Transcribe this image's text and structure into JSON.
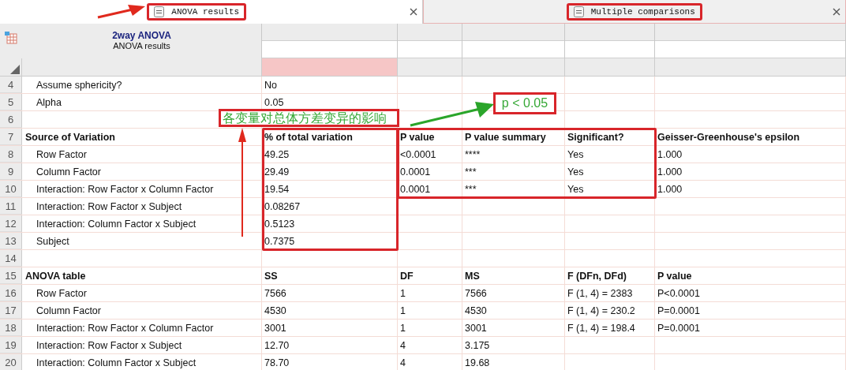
{
  "tabs": [
    {
      "label": "ANOVA results",
      "selected": true
    },
    {
      "label": "Multiple comparisons",
      "selected": false
    }
  ],
  "sheet": {
    "title": "2way ANOVA",
    "subtitle": "ANOVA results",
    "columns": [
      {
        "selected": false
      },
      {
        "selected": true
      },
      {
        "selected": false
      },
      {
        "selected": false
      },
      {
        "selected": false
      },
      {
        "selected": false
      }
    ],
    "rows": [
      {
        "number": "4",
        "kind": "item",
        "cells": [
          "Assume sphericity?",
          "No",
          "",
          "",
          "",
          ""
        ]
      },
      {
        "number": "5",
        "kind": "item",
        "cells": [
          "Alpha",
          "0.05",
          "",
          "",
          "",
          ""
        ]
      },
      {
        "number": "6",
        "kind": "blank",
        "cells": [
          "",
          "",
          "",
          "",
          "",
          ""
        ]
      },
      {
        "number": "7",
        "kind": "heading",
        "cells": [
          "Source of Variation",
          "% of total variation",
          "P value",
          "P value summary",
          "Significant?",
          "Geisser-Greenhouse's epsilon"
        ]
      },
      {
        "number": "8",
        "kind": "item",
        "cells": [
          "Row Factor",
          "49.25",
          "<0.0001",
          "****",
          "Yes",
          "1.000"
        ]
      },
      {
        "number": "9",
        "kind": "item",
        "cells": [
          "Column Factor",
          "29.49",
          "0.0001",
          "***",
          "Yes",
          "1.000"
        ]
      },
      {
        "number": "10",
        "kind": "item",
        "cells": [
          "Interaction: Row Factor x Column Factor",
          "19.54",
          "0.0001",
          "***",
          "Yes",
          "1.000"
        ]
      },
      {
        "number": "11",
        "kind": "item",
        "cells": [
          "Interaction: Row Factor x Subject",
          "0.08267",
          "",
          "",
          "",
          ""
        ]
      },
      {
        "number": "12",
        "kind": "item",
        "cells": [
          "Interaction: Column Factor x Subject",
          "0.5123",
          "",
          "",
          "",
          ""
        ]
      },
      {
        "number": "13",
        "kind": "item",
        "cells": [
          "Subject",
          "0.7375",
          "",
          "",
          "",
          ""
        ]
      },
      {
        "number": "14",
        "kind": "blank",
        "cells": [
          "",
          "",
          "",
          "",
          "",
          ""
        ]
      },
      {
        "number": "15",
        "kind": "heading",
        "cells": [
          "ANOVA table",
          "SS",
          "DF",
          "MS",
          "F (DFn, DFd)",
          "P value"
        ]
      },
      {
        "number": "16",
        "kind": "item",
        "cells": [
          "Row Factor",
          "7566",
          "1",
          "7566",
          "F (1, 4) = 2383",
          "P<0.0001"
        ]
      },
      {
        "number": "17",
        "kind": "item",
        "cells": [
          "Column Factor",
          "4530",
          "1",
          "4530",
          "F (1, 4) = 230.2",
          "P=0.0001"
        ]
      },
      {
        "number": "18",
        "kind": "item",
        "cells": [
          "Interaction: Row Factor x Column Factor",
          "3001",
          "1",
          "3001",
          "F (1, 4) = 198.4",
          "P=0.0001"
        ]
      },
      {
        "number": "19",
        "kind": "item",
        "cells": [
          "Interaction: Row Factor x Subject",
          "12.70",
          "4",
          "3.175",
          "",
          ""
        ]
      },
      {
        "number": "20",
        "kind": "item",
        "cells": [
          "Interaction: Column Factor x Subject",
          "78.70",
          "4",
          "19.68",
          "",
          ""
        ]
      }
    ]
  },
  "annotations": [
    {
      "text": "各变量对总体方差变异的影响"
    },
    {
      "text": "p < 0.05"
    }
  ]
}
